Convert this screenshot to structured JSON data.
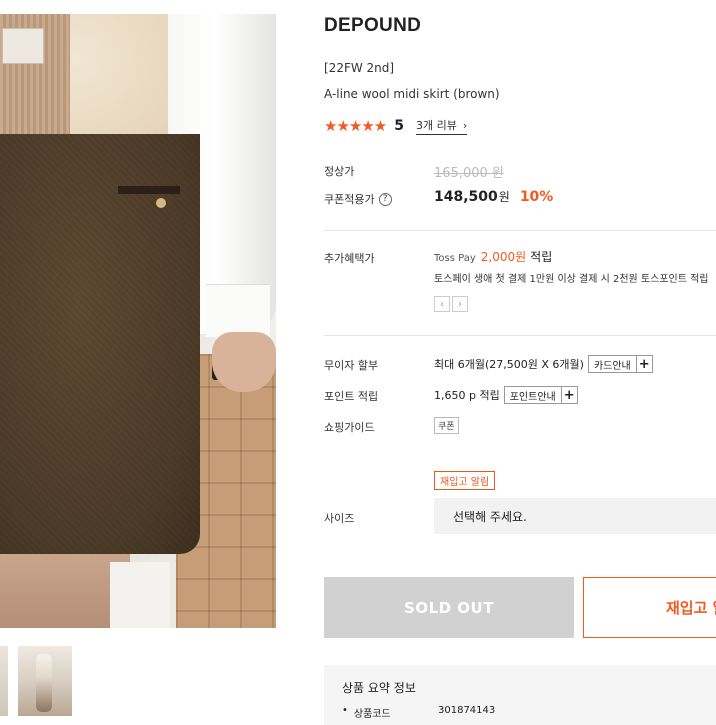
{
  "product": {
    "brand": "DEPOUND",
    "tag": "[22FW 2nd]",
    "name": "A-line wool midi skirt (brown)",
    "rating": {
      "stars": "★★★★★",
      "score": "5",
      "reviews": "3개 리뷰"
    },
    "price": {
      "regular_label": "정상가",
      "regular": "165,000 원",
      "coupon_label": "쿠폰적용가",
      "coupon_price": "148,500",
      "won": "원",
      "discount": "10%"
    }
  },
  "benefits": {
    "label": "추가혜택가",
    "toss": "Toss Pay",
    "amount": "2,000원",
    "earn": "적립",
    "desc": "토스페이 생애 첫 결제 1만원 이상 결제 시 2천원 토스포인트 적립",
    "prev": "‹",
    "next": "›"
  },
  "installment": {
    "label": "무이자 할부",
    "value": "최대 6개월(27,500원 X 6개월)",
    "button": "카드안내",
    "plus": "+"
  },
  "points": {
    "label": "포인트 적립",
    "value": "1,650 p 적립",
    "button": "포인트안내",
    "plus": "+"
  },
  "shopping_guide": {
    "label": "쇼핑가이드",
    "chip": "쿠폰"
  },
  "restock_alert": "재입고 알림",
  "size": {
    "label": "사이즈",
    "placeholder": "선택해 주세요."
  },
  "actions": {
    "soldout": "SOLD OUT",
    "restock": "재입고 알림"
  },
  "summary": {
    "title": "상품 요약 정보",
    "code_label": "상품코드",
    "code_value": "301874143"
  },
  "colors": {
    "accent": "#f25a20",
    "soldout_bg": "#d1d1d1"
  }
}
